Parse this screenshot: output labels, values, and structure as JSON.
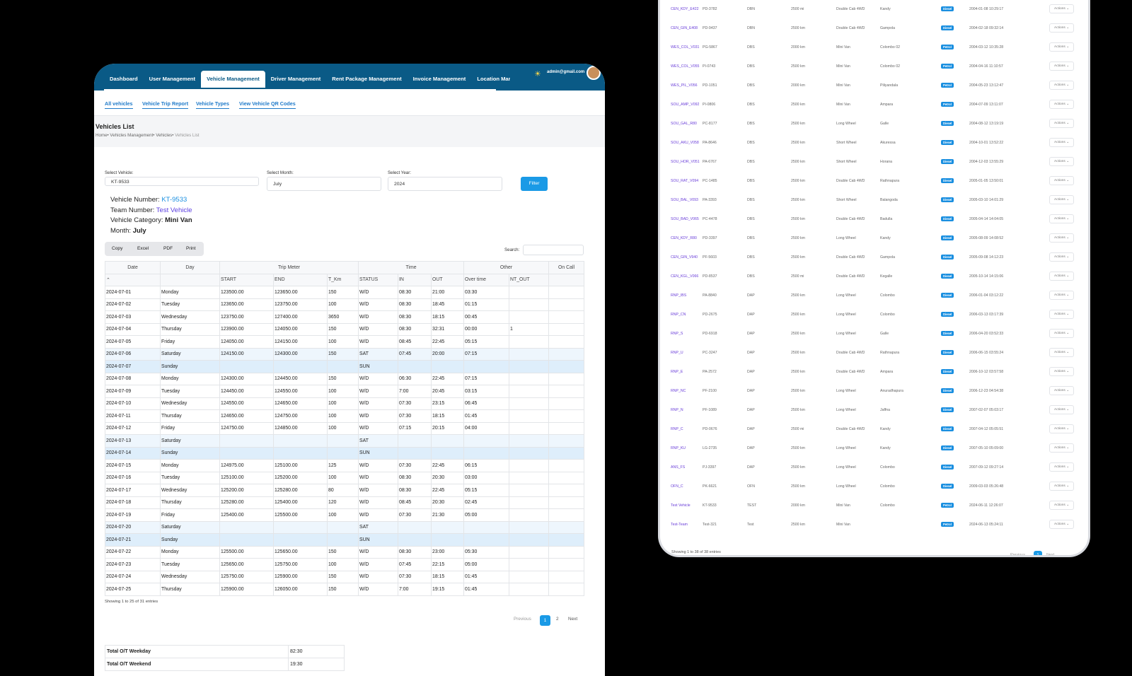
{
  "nav": {
    "items": [
      "Dashboard",
      "User Management",
      "Vehicle Management",
      "Driver Management",
      "Rent Package Management",
      "Invoice Management",
      "Location Manag"
    ],
    "active_index": 2,
    "user_email": "admin@gmail.com"
  },
  "subnav": [
    "All vehicles",
    "Vehicle Trip Report",
    "Vehicle Types",
    "View Vehicle QR Codes"
  ],
  "page": {
    "title": "Vehicles List",
    "breadcrumb": [
      "Home",
      "Vehicles Management",
      "Vehicles",
      "Vehicles List"
    ]
  },
  "filters": {
    "vehicle_label": "Select Vehicle:",
    "vehicle_value": "KT-9533",
    "month_label": "Select Month:",
    "month_value": "July",
    "year_label": "Select Year:",
    "year_value": "2024",
    "button": "Filter"
  },
  "info": {
    "vehicle_number_label": "Vehicle Number:",
    "vehicle_number": "KT-9533",
    "team_number_label": "Team Number:",
    "team_number": "Test Vehicle",
    "vehicle_category_label": "Vehicle Category:",
    "vehicle_category": "Mini Van",
    "month_label": "Month:",
    "month": "July"
  },
  "export_buttons": [
    "Copy",
    "Excel",
    "PDF",
    "Print"
  ],
  "search_label": "Search:",
  "report": {
    "group_headers": [
      "Date",
      "Day",
      "Trip Meter",
      "Time",
      "Other",
      "On Call"
    ],
    "sub_headers": [
      "START",
      "END",
      "T_Km",
      "STATUS",
      "IN",
      "OUT",
      "Over time",
      "NT_OUT"
    ],
    "rows": [
      [
        "2024-07-01",
        "Monday",
        "123500.00",
        "123650.00",
        "150",
        "W/D",
        "08:30",
        "21:00",
        "03:30",
        "",
        ""
      ],
      [
        "2024-07-02",
        "Tuesday",
        "123650.00",
        "123750.00",
        "100",
        "W/D",
        "08:30",
        "18:45",
        "01:15",
        "",
        ""
      ],
      [
        "2024-07-03",
        "Wednesday",
        "123750.00",
        "127400.00",
        "3650",
        "W/D",
        "08:30",
        "18:15",
        "00:45",
        "",
        ""
      ],
      [
        "2024-07-04",
        "Thursday",
        "123900.00",
        "124050.00",
        "150",
        "W/D",
        "08:30",
        "32:31",
        "00:00",
        "1",
        ""
      ],
      [
        "2024-07-05",
        "Friday",
        "124050.00",
        "124150.00",
        "100",
        "W/D",
        "08:45",
        "22:45",
        "05:15",
        "",
        ""
      ],
      [
        "2024-07-06",
        "Saturday",
        "124150.00",
        "124300.00",
        "150",
        "SAT",
        "07:45",
        "20:00",
        "07:15",
        "",
        ""
      ],
      [
        "2024-07-07",
        "Sunday",
        "",
        "",
        "",
        "SUN",
        "",
        "",
        "",
        "",
        ""
      ],
      [
        "2024-07-08",
        "Monday",
        "124300.00",
        "124450.00",
        "150",
        "W/D",
        "06:30",
        "22:45",
        "07:15",
        "",
        ""
      ],
      [
        "2024-07-09",
        "Tuesday",
        "124450.00",
        "124550.00",
        "100",
        "W/D",
        "7:00",
        "20:45",
        "03:15",
        "",
        ""
      ],
      [
        "2024-07-10",
        "Wednesday",
        "124550.00",
        "124650.00",
        "100",
        "W/D",
        "07:30",
        "23:15",
        "06:45",
        "",
        ""
      ],
      [
        "2024-07-11",
        "Thursday",
        "124650.00",
        "124750.00",
        "100",
        "W/D",
        "07:30",
        "18:15",
        "01:45",
        "",
        ""
      ],
      [
        "2024-07-12",
        "Friday",
        "124750.00",
        "124850.00",
        "100",
        "W/D",
        "07:15",
        "20:15",
        "04:00",
        "",
        ""
      ],
      [
        "2024-07-13",
        "Saturday",
        "",
        "",
        "",
        "SAT",
        "",
        "",
        "",
        "",
        ""
      ],
      [
        "2024-07-14",
        "Sunday",
        "",
        "",
        "",
        "SUN",
        "",
        "",
        "",
        "",
        ""
      ],
      [
        "2024-07-15",
        "Monday",
        "124975.00",
        "125100.00",
        "125",
        "W/D",
        "07:30",
        "22:45",
        "06:15",
        "",
        ""
      ],
      [
        "2024-07-16",
        "Tuesday",
        "125100.00",
        "125200.00",
        "100",
        "W/D",
        "08:30",
        "20:30",
        "03:00",
        "",
        ""
      ],
      [
        "2024-07-17",
        "Wednesday",
        "125200.00",
        "125280.00",
        "80",
        "W/D",
        "08:30",
        "22:45",
        "05:15",
        "",
        ""
      ],
      [
        "2024-07-18",
        "Thursday",
        "125280.00",
        "125400.00",
        "120",
        "W/D",
        "08:45",
        "20:30",
        "02:45",
        "",
        ""
      ],
      [
        "2024-07-19",
        "Friday",
        "125400.00",
        "125500.00",
        "100",
        "W/D",
        "07:30",
        "21:30",
        "05:00",
        "",
        ""
      ],
      [
        "2024-07-20",
        "Saturday",
        "",
        "",
        "",
        "SAT",
        "",
        "",
        "",
        "",
        ""
      ],
      [
        "2024-07-21",
        "Sunday",
        "",
        "",
        "",
        "SUN",
        "",
        "",
        "",
        "",
        ""
      ],
      [
        "2024-07-22",
        "Monday",
        "125500.00",
        "125650.00",
        "150",
        "W/D",
        "08:30",
        "23:00",
        "05:30",
        "",
        ""
      ],
      [
        "2024-07-23",
        "Tuesday",
        "125650.00",
        "125750.00",
        "100",
        "W/D",
        "07:45",
        "22:15",
        "05:00",
        "",
        ""
      ],
      [
        "2024-07-24",
        "Wednesday",
        "125750.00",
        "125900.00",
        "150",
        "W/D",
        "07:30",
        "18:15",
        "01:45",
        "",
        ""
      ],
      [
        "2024-07-25",
        "Thursday",
        "125900.00",
        "126050.00",
        "150",
        "W/D",
        "7:00",
        "19:15",
        "01:45",
        "",
        ""
      ]
    ],
    "footer": "Showing 1 to 25 of 31 entries",
    "pager": {
      "prev": "Previous",
      "page1": "1",
      "page2": "2",
      "next": "Next"
    }
  },
  "totals": [
    {
      "label": "Total O/T Weekday",
      "value": "82:30"
    },
    {
      "label": "Total O/T Weekend",
      "value": "19:30"
    }
  ],
  "vehicles": {
    "rows": [
      [
        "CEN_KDY_E422",
        "PD-3782",
        "DBN",
        "2500 mi",
        "Double Cab 4WD",
        "Kandy",
        "Diesel",
        "2004-01-08 10:29:17"
      ],
      [
        "CEN_GIN_E408",
        "PD-9437",
        "DBN",
        "2500 km",
        "Double Cab 4WD",
        "Gampola",
        "Diesel",
        "2004-02-18 09:32:14"
      ],
      [
        "WES_COL_V031",
        "PG-5867",
        "DBS",
        "2000 km",
        "Mini Van",
        "Colombo 02",
        "Petrol",
        "2004-03-12 10:35:28"
      ],
      [
        "WES_COL_V055",
        "PI-0743",
        "DBS",
        "2500 km",
        "Mini Van",
        "Colombo 02",
        "Petrol",
        "2004-04-16 11:10:57"
      ],
      [
        "WES_PIL_V056",
        "PD-1051",
        "DBS",
        "2000 km",
        "Mini Van",
        "Piliyandala",
        "Petrol",
        "2004-05-23 13:12:47"
      ],
      [
        "SOU_AMP_V092",
        "PI-0806",
        "DBS",
        "2500 km",
        "Mini Van",
        "Ampara",
        "Petrol",
        "2004-07-09 13:11:07"
      ],
      [
        "SOU_GAL_R80",
        "PC-8177",
        "DBS",
        "2500 km",
        "Long Wheel",
        "Galle",
        "Diesel",
        "2004-08-12 13:19:19"
      ],
      [
        "SOU_AKU_V058",
        "PA-8646",
        "DBS",
        "2500 km",
        "Short Wheel",
        "Akuressa",
        "Diesel",
        "2004-10-01 13:52:22"
      ],
      [
        "SOU_HOR_V051",
        "PA-6767",
        "DBS",
        "2500 km",
        "Short Wheel",
        "Horana",
        "Diesel",
        "2004-12-03 13:55:29"
      ],
      [
        "SOU_RAT_V094",
        "PC-1485",
        "DBS",
        "2500 km",
        "Double Cab 4WD",
        "Rathnapura",
        "Diesel",
        "2005-01-05 13:50:01"
      ],
      [
        "SOU_BAL_V093",
        "PA-3393",
        "DBS",
        "2500 km",
        "Short Wheel",
        "Balangoda",
        "Diesel",
        "2005-03-10 14:01:29"
      ],
      [
        "SOU_BAD_V065",
        "PC-4478",
        "DBS",
        "2500 km",
        "Double Cab 4WD",
        "Badulla",
        "Diesel",
        "2005-04-14 14:04:05"
      ],
      [
        "CEN_KDY_R80",
        "PD-3397",
        "DBS",
        "2500 km",
        "Long Wheel",
        "Kandy",
        "Diesel",
        "2005-08-09 14:08:52"
      ],
      [
        "CEN_GIN_V940",
        "PF-5603",
        "DBS",
        "2500 km",
        "Double Cab 4WD",
        "Gampola",
        "Diesel",
        "2005-09-08 14:12:23"
      ],
      [
        "CEN_KGL_V066",
        "PD-8537",
        "DBS",
        "2500 mi",
        "Double Cab 4WD",
        "Kegalle",
        "Diesel",
        "2005-10-14 14:15:06"
      ],
      [
        "RNP_IBS",
        "PA-8840",
        "DAP",
        "2500 km",
        "Long Wheel",
        "Colombo",
        "Diesel",
        "2006-01-04 03:12:22"
      ],
      [
        "RNP_CN",
        "PD-2675",
        "DAP",
        "2500 km",
        "Long Wheel",
        "Colombo",
        "Diesel",
        "2006-03-13 03:17:39"
      ],
      [
        "RNP_S",
        "PD-6918",
        "DAP",
        "2500 km",
        "Long Wheel",
        "Galle",
        "Diesel",
        "2006-04-20 03:52:33"
      ],
      [
        "RNP_U",
        "PC-3247",
        "DAP",
        "2500 km",
        "Double Cab 4WD",
        "Rathnapura",
        "Diesel",
        "2006-06-15 03:55:24"
      ],
      [
        "RNP_E",
        "PA-2572",
        "DAP",
        "2500 km",
        "Double Cab 4WD",
        "Ampara",
        "Diesel",
        "2006-10-12 03:57:58"
      ],
      [
        "RNP_NC",
        "PF-2100",
        "DAP",
        "2500 km",
        "Long Wheel",
        "Anuradhapura",
        "Diesel",
        "2006-12-23 04:54:38"
      ],
      [
        "RNP_N",
        "PF-1089",
        "DAP",
        "2500 km",
        "Long Wheel",
        "Jaffna",
        "Diesel",
        "2007-02-07 05:03:17"
      ],
      [
        "RNP_C",
        "PD-0676",
        "DAP",
        "2500 mi",
        "Double Cab 4WD",
        "Kandy",
        "Diesel",
        "2007-04-12 05:05:51"
      ],
      [
        "RNP_KU",
        "LG-2735",
        "DAP",
        "2500 km",
        "Long Wheel",
        "Kandy",
        "Diesel",
        "2007-05-10 05:09:00"
      ],
      [
        "ANS_FS",
        "PJ-3397",
        "DAP",
        "2500 km",
        "Long Wheel",
        "Colombo",
        "Diesel",
        "2007-09-12 09:27:14"
      ],
      [
        "OFN_C",
        "PK-6621",
        "OFN",
        "2500 km",
        "Long Wheel",
        "Colombo",
        "Diesel",
        "2009-03-03 05:26:48"
      ],
      [
        "Test Vehicle",
        "KT-9533",
        "TEST",
        "2000 km",
        "Mini Van",
        "Colombo",
        "Petrol",
        "2024-06-11 12:26:07"
      ],
      [
        "Test-Team",
        "Test-321",
        "Test",
        "2500 km",
        "Mini Van",
        "",
        "Petrol",
        "2024-06-13 05:24:11"
      ]
    ],
    "actions_label": "Actions ⌄",
    "footer": "Showing 1 to 38 of 38 entries",
    "pager": {
      "prev": "Previous",
      "page1": "1",
      "next": "Next"
    }
  }
}
